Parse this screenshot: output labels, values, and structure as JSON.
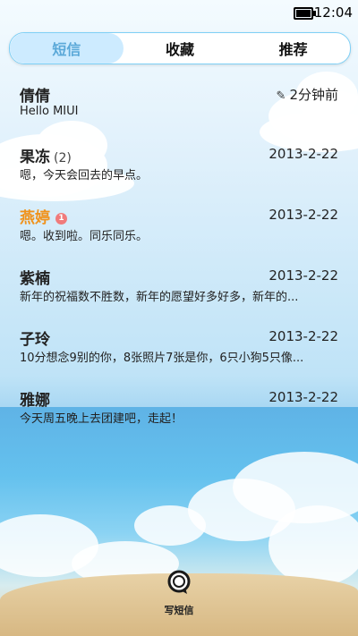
{
  "status_bar": {
    "time": "12:04",
    "battery_level": 0.9
  },
  "tabs": [
    {
      "label": "短信",
      "active": true
    },
    {
      "label": "收藏",
      "active": false
    },
    {
      "label": "推荐",
      "active": false
    }
  ],
  "messages": [
    {
      "name": "倩倩",
      "count": "",
      "badge": "",
      "date": "2分钟前",
      "draft_icon": "pencil-icon",
      "preview": "Hello MIUI",
      "unread": false
    },
    {
      "name": "果冻",
      "count": "(2)",
      "badge": "",
      "date": "2013-2-22",
      "preview": "嗯，今天会回去的早点。",
      "unread": false
    },
    {
      "name": "燕婷",
      "count": "",
      "badge": "1",
      "date": "2013-2-22",
      "preview": "嗯。收到啦。同乐同乐。",
      "unread": true
    },
    {
      "name": "紫楠",
      "count": "",
      "badge": "",
      "date": "2013-2-22",
      "preview": "新年的祝福数不胜数，新年的愿望好多好多，新年的...",
      "unread": false
    },
    {
      "name": "子玲",
      "count": "",
      "badge": "",
      "date": "2013-2-22",
      "preview": "10分想念9别的你，8张照片7张是你，6只小狗5只像...",
      "unread": false
    },
    {
      "name": "雅娜",
      "count": "",
      "badge": "",
      "date": "2013-2-22",
      "preview": "今天周五晚上去团建吧，走起！",
      "unread": false
    }
  ],
  "compose": {
    "label": "写短信",
    "icon": "compose-message-icon"
  },
  "colors": {
    "accent": "#5aa8d8",
    "unread_name": "#f0921a",
    "badge": "#f07b7b"
  }
}
